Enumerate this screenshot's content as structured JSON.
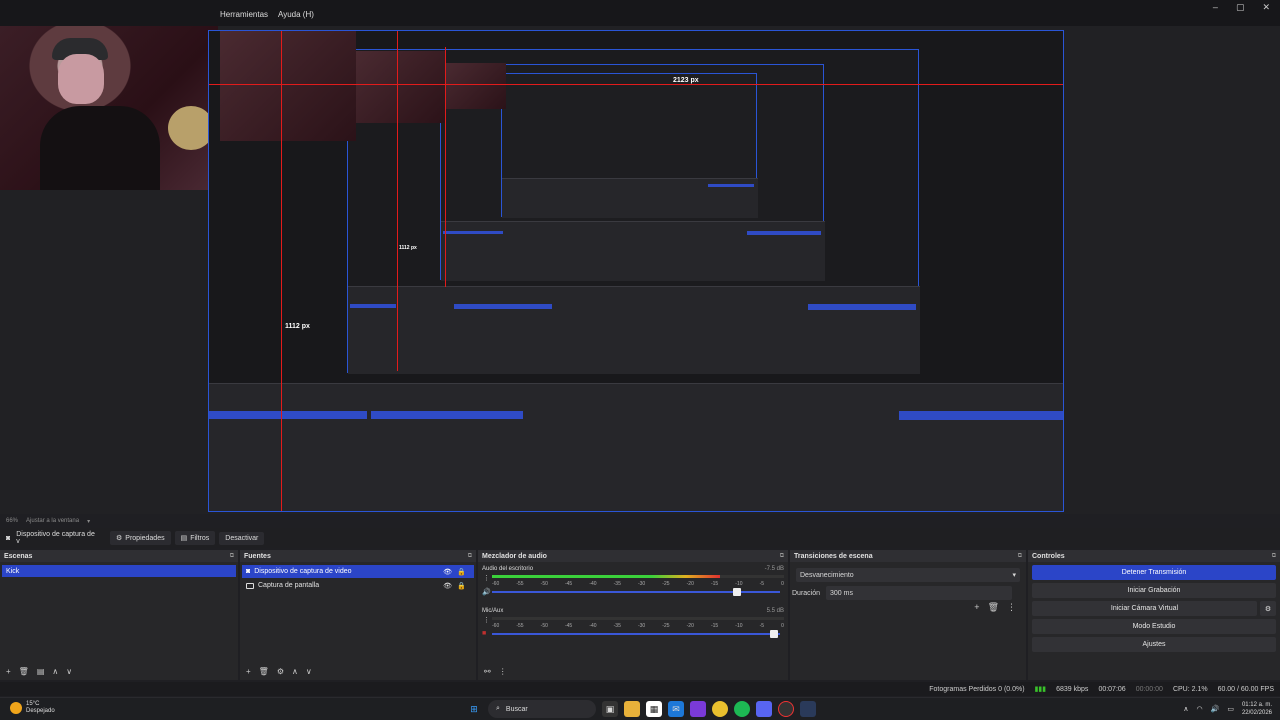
{
  "menubar": {
    "tools": "Herramientas",
    "help": "Ayuda (H)"
  },
  "window_controls": {
    "minimize": "–",
    "maximize": "▢",
    "close": "✕"
  },
  "preview": {
    "nested_menu": [
      "Herramientas",
      "Ayuda (H)"
    ],
    "measure_top": "2123 px",
    "measure_left": "1112 px",
    "measure_mid": "1112 px"
  },
  "zoom": {
    "value": "66%",
    "fit_label": "Ajustar a la ventana"
  },
  "source_toolbar": {
    "source_name": "Dispositivo de captura de v",
    "properties": "Propiedades",
    "filters": "Filtros",
    "deactivate": "Desactivar"
  },
  "scenes": {
    "title": "Escenas",
    "items": [
      "Kick"
    ]
  },
  "sources": {
    "title": "Fuentes",
    "items": [
      {
        "name": "Dispositivo de captura de video",
        "selected": true
      },
      {
        "name": "Captura de pantalla",
        "selected": false
      }
    ]
  },
  "mixer": {
    "title": "Mezclador de audio",
    "ticks": [
      "-60",
      "-55",
      "-50",
      "-45",
      "-40",
      "-35",
      "-30",
      "-25",
      "-20",
      "-15",
      "-10",
      "-5",
      "0"
    ],
    "channels": [
      {
        "name": "Audio del escritorio",
        "db": "-7.5 dB",
        "level": 0.78,
        "volume": 0.85
      },
      {
        "name": "Mic/Aux",
        "db": "5.5 dB",
        "level": 0.0,
        "volume": 0.98
      }
    ]
  },
  "transitions": {
    "title": "Transiciones de escena",
    "selected": "Desvanecimiento",
    "duration_label": "Duración",
    "duration_value": "300 ms"
  },
  "controls": {
    "title": "Controles",
    "stop_stream": "Detener Transmisión",
    "start_recording": "Iniciar Grabación",
    "virtual_camera": "Iniciar Cámara Virtual",
    "studio_mode": "Modo Estudio",
    "settings": "Ajustes"
  },
  "status": {
    "dropped_frames": "Fotogramas Perdidos 0 (0.0%)",
    "bitrate": "6839 kbps",
    "stream_time": "00:07:06",
    "rec_time": "00:00:00",
    "cpu": "CPU: 2.1%",
    "fps": "60.00 / 60.00 FPS"
  },
  "taskbar": {
    "temp": "15°C",
    "weather": "Despejado",
    "search": "Buscar",
    "time": "01:12 a. m.",
    "date": "22/02/2026"
  },
  "colors": {
    "accent": "#2b45c8",
    "meter_green": "#3bd13b",
    "meter_yellow": "#e0b020",
    "meter_red": "#e03030",
    "guide_red": "#e21b1b"
  }
}
